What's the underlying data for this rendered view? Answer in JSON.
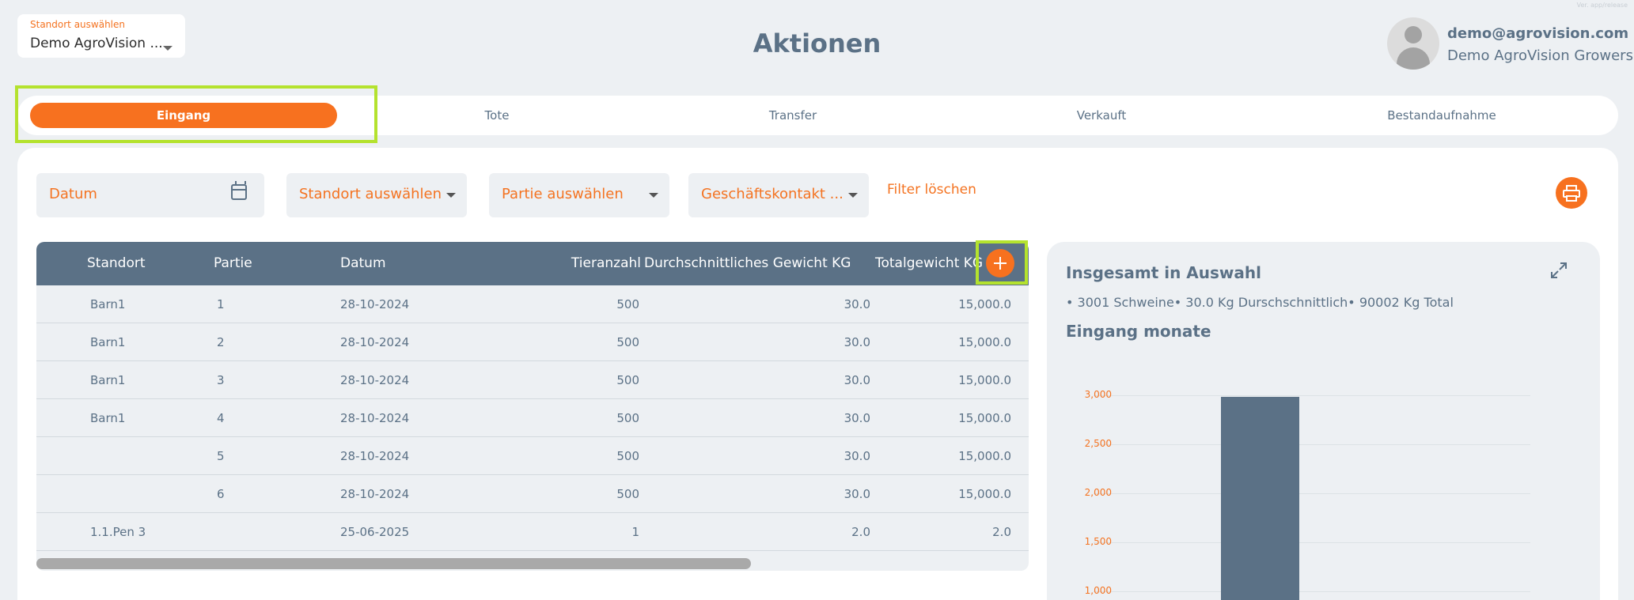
{
  "header": {
    "site_select_label": "Standort auswählen",
    "site_select_value": "Demo AgroVision ...",
    "title": "Aktionen",
    "user_email": "demo@agrovision.com",
    "user_org": "Demo AgroVision Growers",
    "tiny_note": "Ver. app/release"
  },
  "tabs": [
    "Eingang",
    "Tote",
    "Transfer",
    "Verkauft",
    "Bestandaufnahme"
  ],
  "active_tab": "Eingang",
  "filters": {
    "date_placeholder": "Datum",
    "site": "Standort auswählen",
    "batch": "Partie auswählen",
    "contact": "Geschäftskontakt ...",
    "clear": "Filter löschen"
  },
  "table": {
    "columns": [
      "Standort",
      "Partie",
      "Datum",
      "Tieranzahl",
      "Durchschnittliches Gewicht KG",
      "Totalgewicht KG"
    ],
    "rows": [
      [
        "Barn1",
        "1",
        "28-10-2024",
        "500",
        "30.0",
        "15,000.0"
      ],
      [
        "Barn1",
        "2",
        "28-10-2024",
        "500",
        "30.0",
        "15,000.0"
      ],
      [
        "Barn1",
        "3",
        "28-10-2024",
        "500",
        "30.0",
        "15,000.0"
      ],
      [
        "Barn1",
        "4",
        "28-10-2024",
        "500",
        "30.0",
        "15,000.0"
      ],
      [
        "",
        "5",
        "28-10-2024",
        "500",
        "30.0",
        "15,000.0"
      ],
      [
        "",
        "6",
        "28-10-2024",
        "500",
        "30.0",
        "15,000.0"
      ],
      [
        "1.1.Pen 3",
        "",
        "25-06-2025",
        "1",
        "2.0",
        "2.0"
      ]
    ],
    "scroll_position": 0.72
  },
  "summary": {
    "title": "Insgesamt in Auswahl",
    "text": "• 3001 Schweine• 30.0 Kg Durschschnittlich• 90002 Kg Total",
    "chart_title": "Eingang monate"
  },
  "chart_data": {
    "type": "bar",
    "title": "Eingang monate",
    "xlabel": "",
    "ylabel": "",
    "yticks": [
      "3,000",
      "2,500",
      "2,000",
      "1,500",
      "1,000"
    ],
    "ylim_visible": [
      1000,
      3000
    ],
    "values": [
      3000
    ],
    "colors": {
      "bar": "#5b7186",
      "tick": "#f47321"
    }
  },
  "colors": {
    "accent": "#f7711f",
    "primary": "#5b7186",
    "highlight": "#b4e22e"
  }
}
